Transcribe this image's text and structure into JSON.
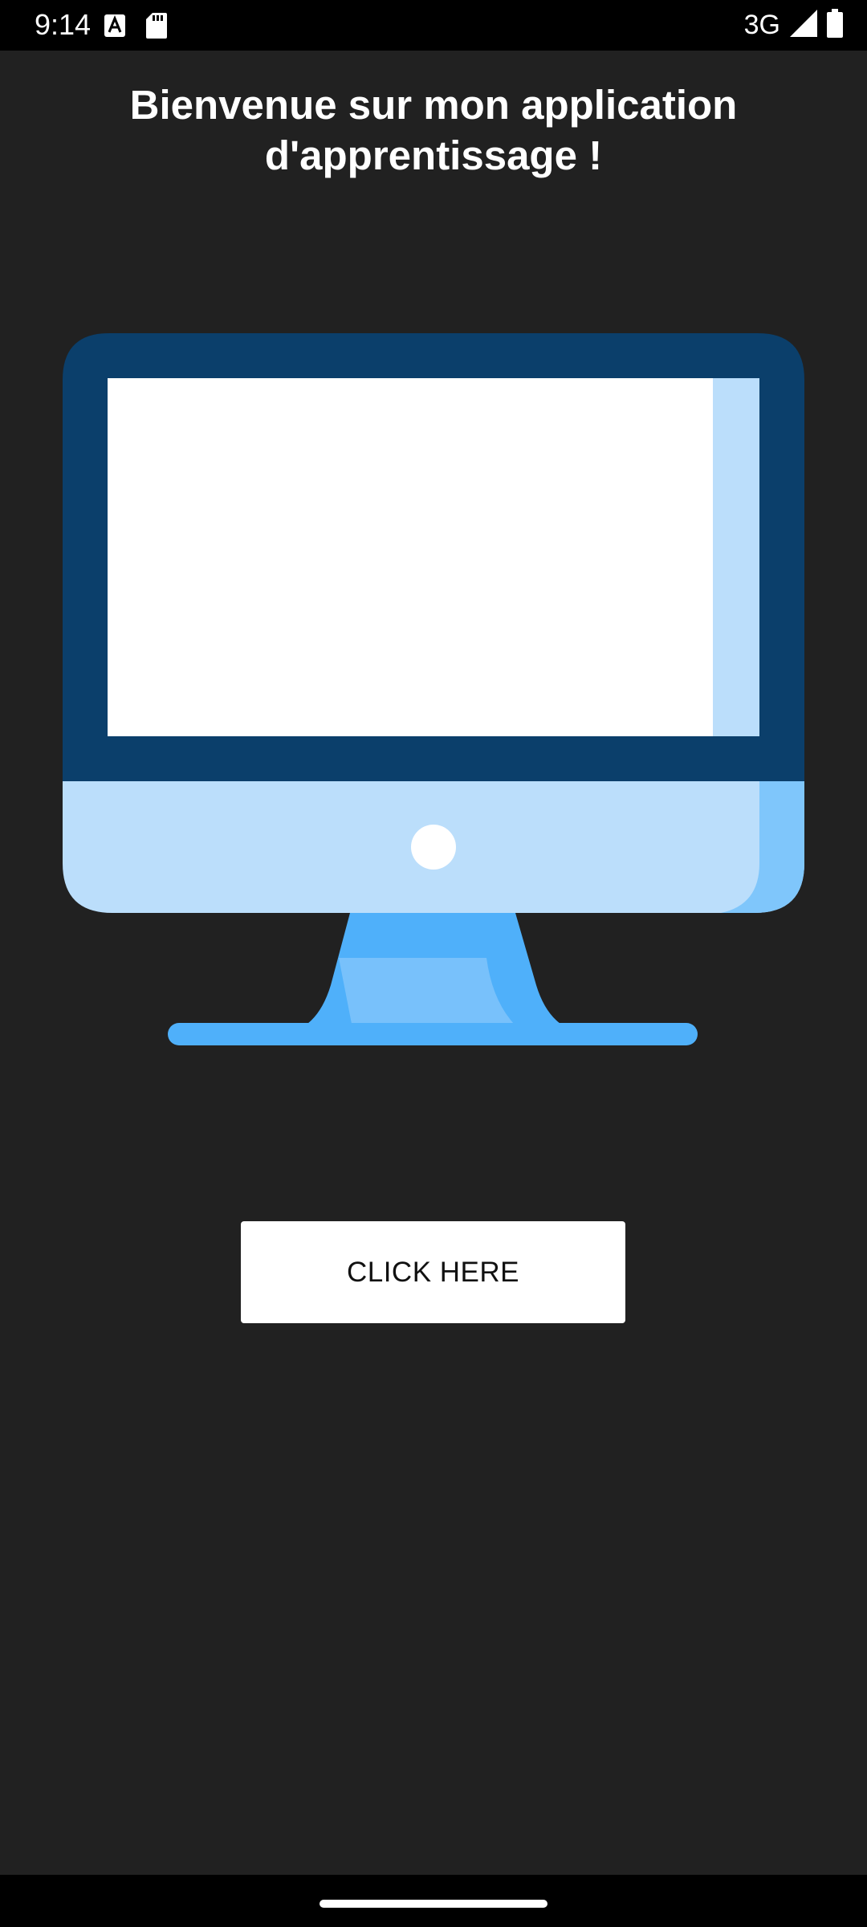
{
  "status_bar": {
    "time": "9:14",
    "network": "3G",
    "icons": [
      "text-notification-icon",
      "sd-card-icon",
      "cellular-signal-icon",
      "battery-icon"
    ]
  },
  "main": {
    "headline": "Bienvenue sur mon application d'apprentissage !",
    "illustration_icon": "desktop-monitor-icon",
    "button_label": "CLICK HERE"
  },
  "colors": {
    "background": "#212121",
    "monitor_frame": "#0b3f6b",
    "monitor_chin": "#bbdefb",
    "monitor_stand": "#4fb0fa",
    "button_background": "#ffffff"
  }
}
